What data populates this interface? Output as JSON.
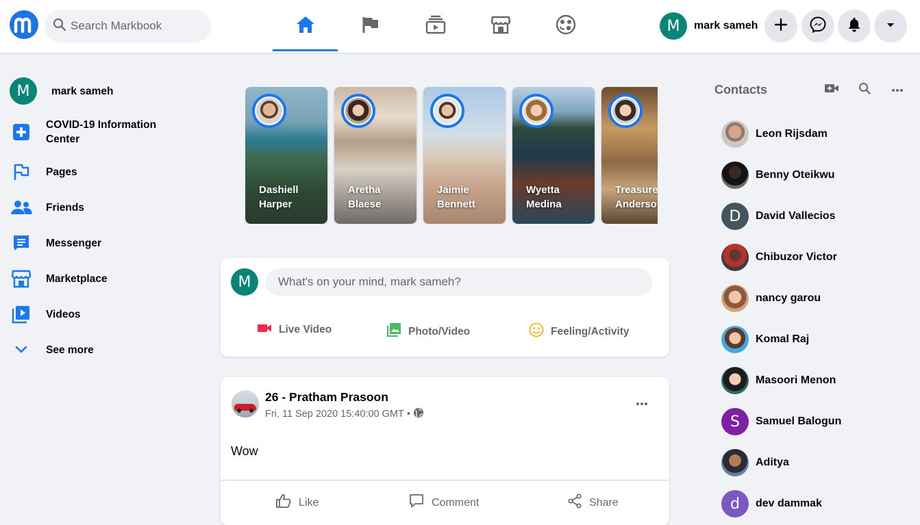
{
  "app": {
    "name": "Markbook",
    "logo_letter": "m"
  },
  "header": {
    "search_placeholder": "Search Markbook",
    "tabs": [
      {
        "name": "home",
        "icon": "home-icon",
        "active": true
      },
      {
        "name": "pages",
        "icon": "flag-icon",
        "active": false
      },
      {
        "name": "watch",
        "icon": "video-stack-icon",
        "active": false
      },
      {
        "name": "marketplace",
        "icon": "storefront-icon",
        "active": false
      },
      {
        "name": "groups",
        "icon": "gaming-face-icon",
        "active": false
      }
    ],
    "user": {
      "name": "mark sameh",
      "initial": "M"
    },
    "buttons": [
      "plus-icon",
      "messenger-icon",
      "bell-icon",
      "caret-down-icon"
    ]
  },
  "sidebar": {
    "profile": {
      "name": "mark sameh",
      "initial": "M"
    },
    "items": [
      {
        "label": "COVID-19 Information Center",
        "icon": "plus-square-icon"
      },
      {
        "label": "Pages",
        "icon": "flag-icon"
      },
      {
        "label": "Friends",
        "icon": "people-icon"
      },
      {
        "label": "Messenger",
        "icon": "chat-icon"
      },
      {
        "label": "Marketplace",
        "icon": "storefront-icon"
      },
      {
        "label": "Videos",
        "icon": "video-icon"
      },
      {
        "label": "See more",
        "icon": "chevron-down-icon"
      }
    ]
  },
  "stories": [
    {
      "first": "Dashiell",
      "last": "Harper"
    },
    {
      "first": "Aretha",
      "last": "Blaese"
    },
    {
      "first": "Jaimie",
      "last": "Bennett"
    },
    {
      "first": "Wyetta",
      "last": "Medina"
    },
    {
      "first": "Treasure",
      "last": "Anderson"
    }
  ],
  "composer": {
    "user_initial": "M",
    "placeholder": "What's on your mind, mark sameh?",
    "actions": [
      {
        "label": "Live Video",
        "icon": "live-video-icon",
        "color": "#f02849"
      },
      {
        "label": "Photo/Video",
        "icon": "photo-icon",
        "color": "#45bd62"
      },
      {
        "label": "Feeling/Activity",
        "icon": "smiley-icon",
        "color": "#f7b928"
      }
    ]
  },
  "post": {
    "author": "26 - Pratham Prasoon",
    "timestamp": "Fri, 11 Sep 2020 15:40:00 GMT",
    "separator": "•",
    "body": "Wow",
    "actions": [
      {
        "label": "Like",
        "icon": "thumbs-up-icon"
      },
      {
        "label": "Comment",
        "icon": "comment-icon"
      },
      {
        "label": "Share",
        "icon": "share-icon"
      }
    ]
  },
  "contacts": {
    "title": "Contacts",
    "people": [
      {
        "name": "Leon Rijsdam",
        "avatar": "photo"
      },
      {
        "name": "Benny Oteikwu",
        "avatar": "photo"
      },
      {
        "name": "David Vallecios",
        "avatar": "letter",
        "initial": "D",
        "color": "#44555f"
      },
      {
        "name": "Chibuzor Victor",
        "avatar": "photo"
      },
      {
        "name": "nancy garou",
        "avatar": "photo"
      },
      {
        "name": "Komal Raj",
        "avatar": "photo"
      },
      {
        "name": "Masoori Menon",
        "avatar": "photo"
      },
      {
        "name": "Samuel Balogun",
        "avatar": "letter",
        "initial": "S",
        "color": "#7e1fa5"
      },
      {
        "name": "Aditya",
        "avatar": "photo"
      },
      {
        "name": "dev dammak",
        "avatar": "letter",
        "initial": "d",
        "color": "#7b57c2"
      }
    ]
  },
  "colors": {
    "brand": "#1877f2",
    "avatar_green": "#0b8478"
  }
}
